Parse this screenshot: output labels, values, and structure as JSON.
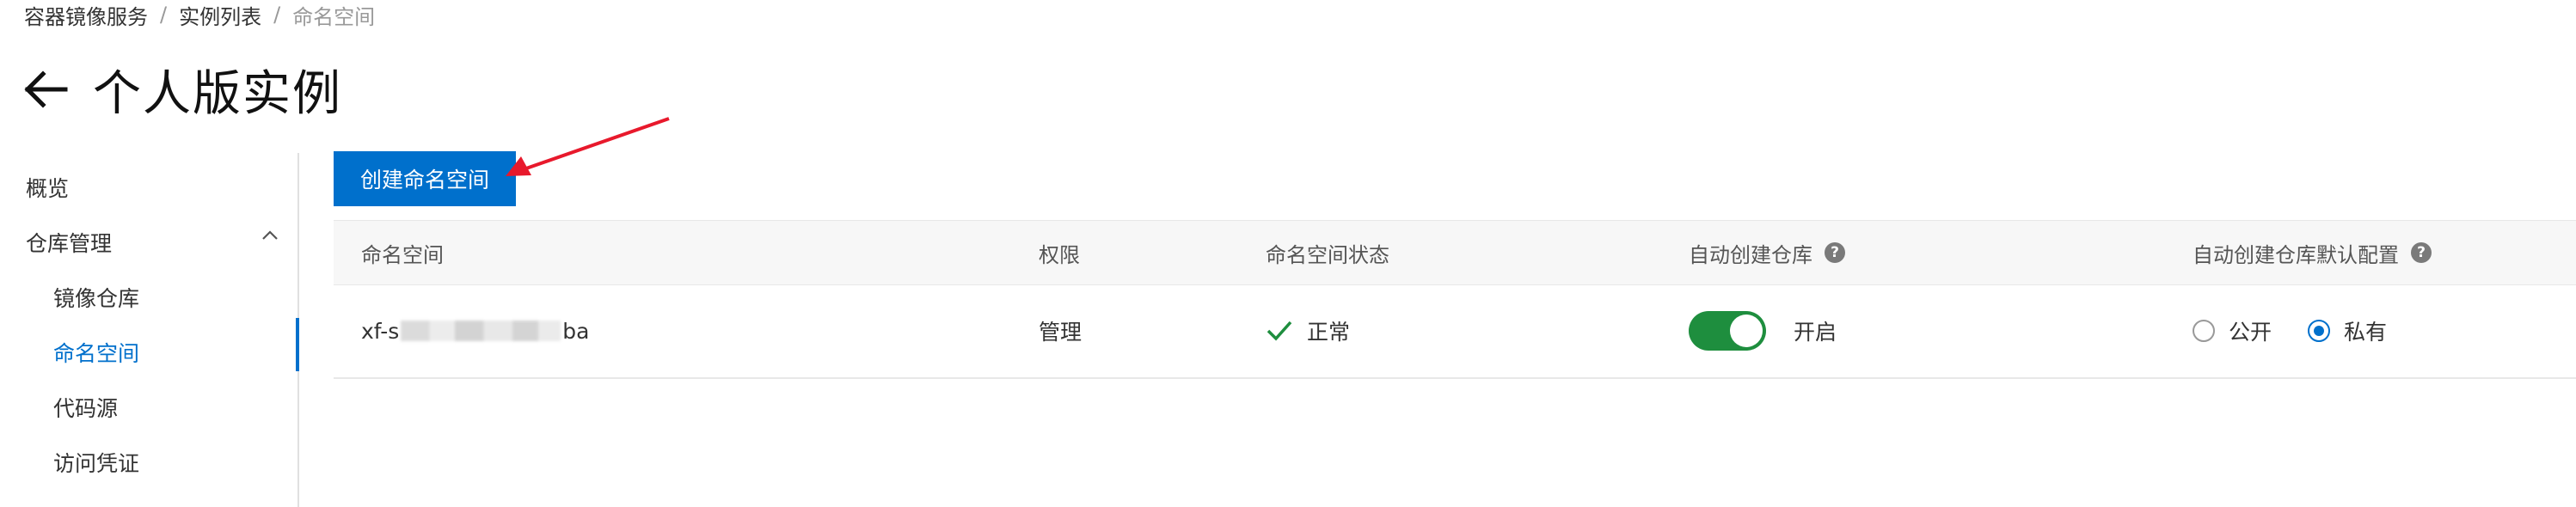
{
  "breadcrumb": {
    "items": [
      "容器镜像服务",
      "实例列表",
      "命名空间"
    ],
    "separator": "/"
  },
  "page": {
    "title": "个人版实例"
  },
  "sidebar": {
    "items": [
      {
        "label": "概览"
      },
      {
        "label": "仓库管理"
      },
      {
        "label": "镜像仓库"
      },
      {
        "label": "命名空间"
      },
      {
        "label": "代码源"
      },
      {
        "label": "访问凭证"
      }
    ],
    "active": "命名空间"
  },
  "toolbar": {
    "create_label": "创建命名空间"
  },
  "table": {
    "columns": [
      "命名空间",
      "权限",
      "命名空间状态",
      "自动创建仓库",
      "自动创建仓库默认配置"
    ],
    "rows": [
      {
        "name_prefix": "xf-s",
        "name_suffix": "ba",
        "permission": "管理",
        "status": "正常",
        "auto_create_label": "开启",
        "auto_create_on": true,
        "visibility_options": [
          "公开",
          "私有"
        ],
        "visibility_selected": "私有"
      }
    ]
  },
  "colors": {
    "accent": "#0070cc",
    "toggle_on": "#1e8e3e",
    "status_ok": "#1e8e3e",
    "annotation": "#e8192c"
  },
  "icons": {
    "back": "arrow-left-icon",
    "collapse": "chevron-up-icon",
    "help": "question-circle-icon",
    "status": "check-icon"
  }
}
